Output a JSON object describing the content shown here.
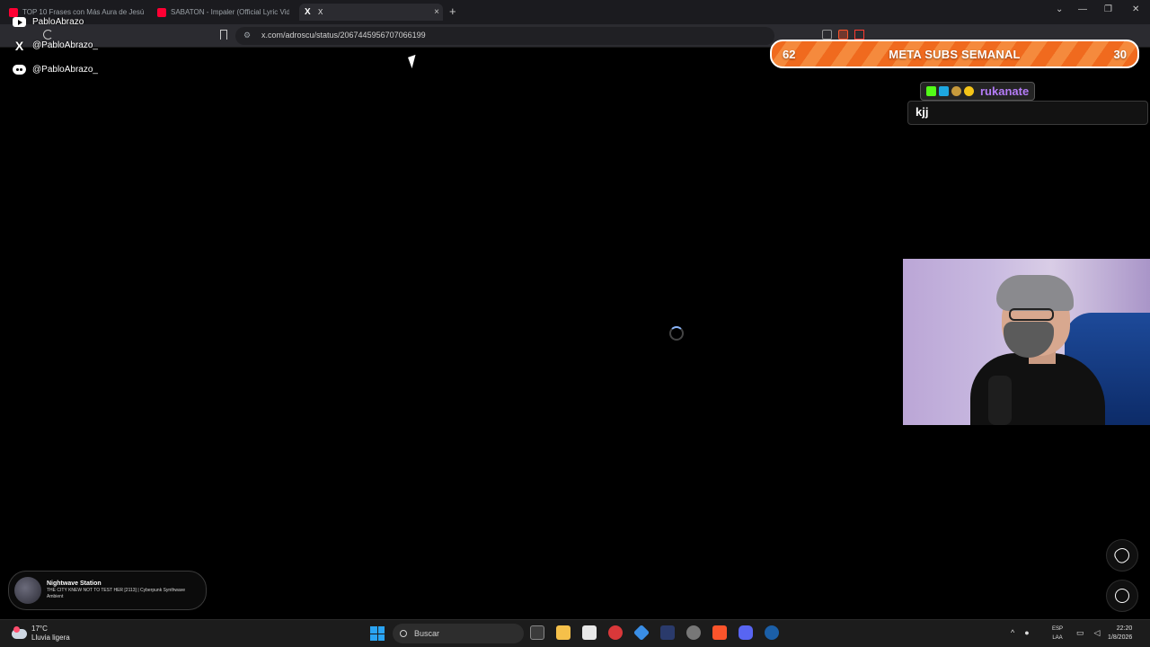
{
  "browser": {
    "tabs": [
      {
        "title": "TOP 10 Frases con Más Aura de Jesús",
        "favicon": "youtube-icon",
        "active": false
      },
      {
        "title": "SABATON - Impaler (Official Lyric Video)",
        "favicon": "youtube-icon",
        "active": false
      },
      {
        "title": "X",
        "favicon": "x-icon",
        "active": true
      }
    ],
    "new_tab_symbol": "+",
    "close_symbol": "×",
    "url": "x.com/adroscu/status/2067445956707066199",
    "window_controls": {
      "chevron": "⌄",
      "minimize": "—",
      "restore": "❐",
      "close": "✕"
    }
  },
  "overlay": {
    "socials": [
      {
        "platform_icon": "youtube-icon",
        "handle": "PabloAbrazo"
      },
      {
        "platform_icon": "x-icon",
        "handle": "@PabloAbrazo_"
      },
      {
        "platform_icon": "discord-icon",
        "handle": "@PabloAbrazo_"
      }
    ],
    "sub_goal": {
      "current": "62",
      "title": "META SUBS SEMANAL",
      "target": "30",
      "colors": {
        "fill": "#f06a1e",
        "stripe": "#f58a3d"
      }
    },
    "chat": {
      "username": "rukanate",
      "username_color": "#b57cf7",
      "message": "kjj",
      "badges": [
        "kick-badge",
        "cube-badge",
        "burger-badge",
        "coin-badge"
      ]
    },
    "now_playing": {
      "station": "Nightwave Station",
      "track": "THE CITY KNEW NOT TO TEST HER [2113] | Cyberpunk Synthwave Ambient"
    }
  },
  "page": {
    "x_logo": "X"
  },
  "taskbar": {
    "weather": {
      "temp": "17°C",
      "condition": "Lluvia ligera"
    },
    "search_placeholder": "Buscar",
    "language": {
      "code": "ESP",
      "region": "LAA"
    },
    "clock": {
      "time": "22:20",
      "date": "1/8/2026"
    },
    "tray_chevron": "^"
  }
}
